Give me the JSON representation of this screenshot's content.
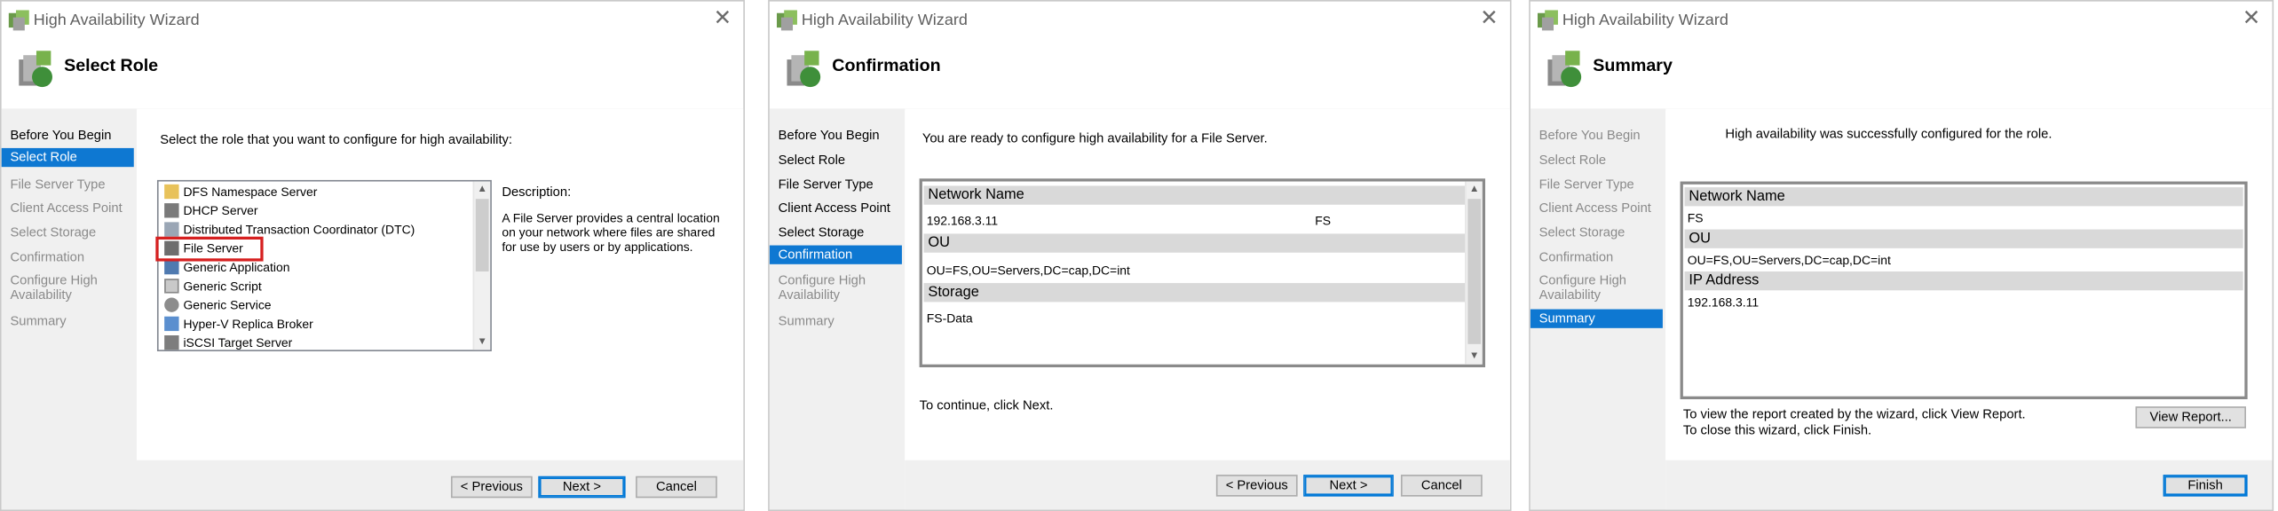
{
  "app_title": "High Availability Wizard",
  "nav_steps": [
    "Before You Begin",
    "Select Role",
    "File Server Type",
    "Client Access Point",
    "Select Storage",
    "Confirmation",
    "Configure High Availability",
    "Summary"
  ],
  "panel1": {
    "title": "Select Role",
    "prompt": "Select the role that you want to configure for high availability:",
    "roles": [
      "DFS Namespace Server",
      "DHCP Server",
      "Distributed Transaction Coordinator (DTC)",
      "File Server",
      "Generic Application",
      "Generic Script",
      "Generic Service",
      "Hyper-V Replica Broker",
      "iSCSI Target Server"
    ],
    "selected_role": "File Server",
    "description_label": "Description:",
    "description_line1": "A File Server provides a central location",
    "description_line2": "on your network where files are shared",
    "description_line3": "for use by users or by applications.",
    "buttons": {
      "previous": "< Previous",
      "next": "Next >",
      "cancel": "Cancel"
    }
  },
  "panel2": {
    "title": "Confirmation",
    "prompt": "You are ready to configure high availability for a File Server.",
    "sections": [
      {
        "header": "Network Name",
        "value": "192.168.3.11",
        "value2": "FS"
      },
      {
        "header": "OU",
        "value": "OU=FS,OU=Servers,DC=cap,DC=int"
      },
      {
        "header": "Storage",
        "value": "FS-Data"
      }
    ],
    "continue_text": "To continue, click Next.",
    "buttons": {
      "previous": "< Previous",
      "next": "Next >",
      "cancel": "Cancel"
    }
  },
  "panel3": {
    "title": "Summary",
    "status": "High availability was successfully configured for the role.",
    "sections": [
      {
        "header": "Network Name",
        "value": "FS"
      },
      {
        "header": "OU",
        "value": "OU=FS,OU=Servers,DC=cap,DC=int"
      },
      {
        "header": "IP Address",
        "value": "192.168.3.11"
      }
    ],
    "report_line1": "To view the report created by the wizard, click View Report.",
    "report_line2": "To close this wizard, click Finish.",
    "buttons": {
      "view_report": "View Report...",
      "finish": "Finish"
    }
  },
  "colors": {
    "accent": "#0e78d2",
    "highlight_box": "#d62020"
  }
}
